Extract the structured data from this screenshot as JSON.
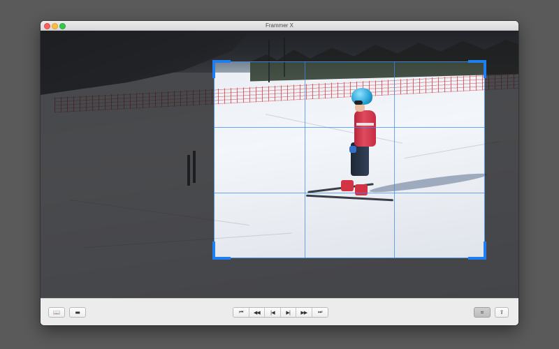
{
  "window": {
    "title": "Frammer X"
  },
  "window_controls": {
    "close_icon": "traffic-light-close",
    "minimize_icon": "traffic-light-minimize",
    "zoom_icon": "traffic-light-zoom"
  },
  "crop": {
    "grid": "rule-of-thirds",
    "handle_color": "#1e7ff2",
    "grid_color": "#3c8ceb"
  },
  "toolbar": {
    "left_buttons": [
      {
        "icon": "book-icon",
        "glyph": "📖"
      },
      {
        "icon": "folder-icon",
        "glyph": "▬"
      }
    ],
    "playback_buttons": [
      {
        "icon": "skip-to-start-icon",
        "glyph": "⏮"
      },
      {
        "icon": "rewind-icon",
        "glyph": "◀◀"
      },
      {
        "icon": "step-back-icon",
        "glyph": "|◀"
      },
      {
        "icon": "step-forward-icon",
        "glyph": "▶|"
      },
      {
        "icon": "fast-forward-icon",
        "glyph": "▶▶"
      },
      {
        "icon": "skip-to-end-icon",
        "glyph": "⏭"
      }
    ],
    "right_buttons": [
      {
        "icon": "crop-icon",
        "glyph": "⌗",
        "active": true
      },
      {
        "icon": "share-icon",
        "glyph": "⇪",
        "active": false
      }
    ]
  }
}
